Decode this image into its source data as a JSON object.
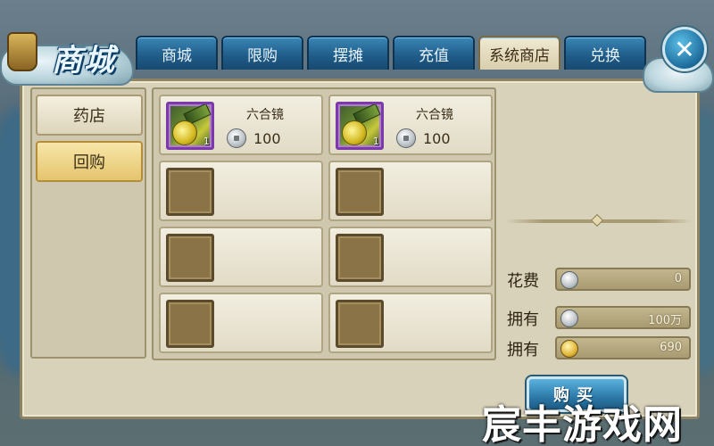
{
  "header": {
    "title": "商城",
    "tabs": [
      {
        "label": "商城",
        "active": false
      },
      {
        "label": "限购",
        "active": false
      },
      {
        "label": "摆摊",
        "active": false
      },
      {
        "label": "充值",
        "active": false
      },
      {
        "label": "系统商店",
        "active": true
      },
      {
        "label": "兑换",
        "active": false
      }
    ],
    "close_icon": "close-icon"
  },
  "sidebar": {
    "items": [
      {
        "label": "药店",
        "active": false
      },
      {
        "label": "回购",
        "active": true
      }
    ]
  },
  "items": {
    "slots": [
      {
        "name": "六合镜",
        "quantity": "1",
        "price": "100",
        "icon": "mirror-icon",
        "filled": true
      },
      {
        "name": "六合镜",
        "quantity": "1",
        "price": "100",
        "icon": "mirror-icon",
        "filled": true
      },
      {
        "name": "",
        "quantity": "",
        "price": "",
        "filled": false
      },
      {
        "name": "",
        "quantity": "",
        "price": "",
        "filled": false
      },
      {
        "name": "",
        "quantity": "",
        "price": "",
        "filled": false
      },
      {
        "name": "",
        "quantity": "",
        "price": "",
        "filled": false
      },
      {
        "name": "",
        "quantity": "",
        "price": "",
        "filled": false
      },
      {
        "name": "",
        "quantity": "",
        "price": "",
        "filled": false
      }
    ],
    "currency_icon": "silver-coin-icon"
  },
  "purchase": {
    "cost_label": "花费",
    "cost_value": "0",
    "owned_silver_label": "拥有",
    "owned_silver_value": "100万",
    "owned_gold_label": "拥有",
    "owned_gold_value": "690",
    "buy_label": "购买"
  },
  "watermark": "宸丰游戏网",
  "colors": {
    "tab_blue": "#1f5b87",
    "panel_bg": "#d8d2bb",
    "active_sidebar": "#e5c46e",
    "item_border_purple": "#7a3aa8"
  }
}
